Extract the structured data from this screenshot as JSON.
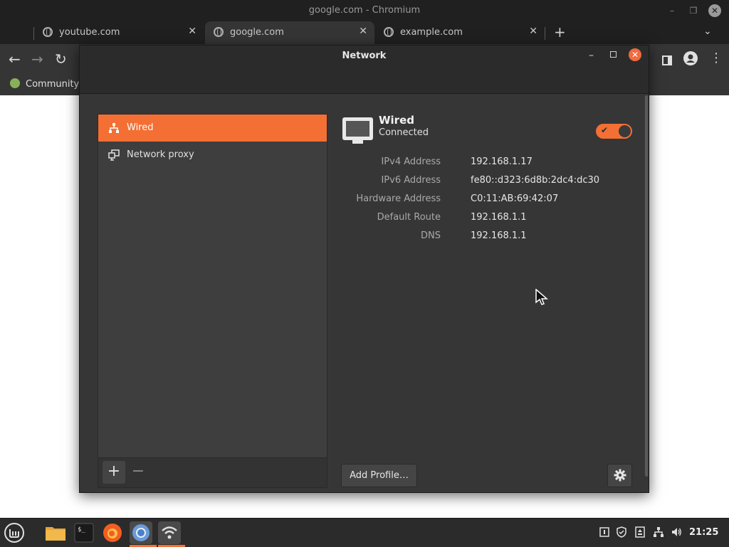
{
  "browser": {
    "window_title": "google.com - Chromium",
    "tabs": [
      {
        "label": "youtube.com",
        "close": "✕"
      },
      {
        "label": "google.com",
        "close": "✕"
      },
      {
        "label": "example.com",
        "close": "✕"
      }
    ],
    "new_tab": "+",
    "tab_menu": "⌄",
    "bookmark": "Community"
  },
  "dialog": {
    "title": "Network",
    "sidebar": [
      {
        "label": "Wired",
        "icon": "wired-network-icon",
        "selected": true
      },
      {
        "label": "Network proxy",
        "icon": "network-proxy-icon",
        "selected": false
      }
    ],
    "add": "+",
    "remove": "−",
    "device": {
      "name": "Wired",
      "status": "Connected",
      "enabled": true
    },
    "details": [
      {
        "label": "IPv4 Address",
        "value": "192.168.1.17"
      },
      {
        "label": "IPv6 Address",
        "value": "fe80::d323:6d8b:2dc4:dc30"
      },
      {
        "label": "Hardware Address",
        "value": "C0:11:AB:69:42:07"
      },
      {
        "label": "Default Route",
        "value": "192.168.1.1"
      },
      {
        "label": "DNS",
        "value": "192.168.1.1"
      }
    ],
    "add_profile": "Add Profile…"
  },
  "taskbar": {
    "clock": "21:25",
    "apps": [
      "menu-icon",
      "files-icon",
      "terminal-icon",
      "firefox-icon",
      "chromium-icon",
      "network-settings-icon"
    ]
  },
  "colors": {
    "accent": "#f46f34",
    "panel": "#363636"
  }
}
